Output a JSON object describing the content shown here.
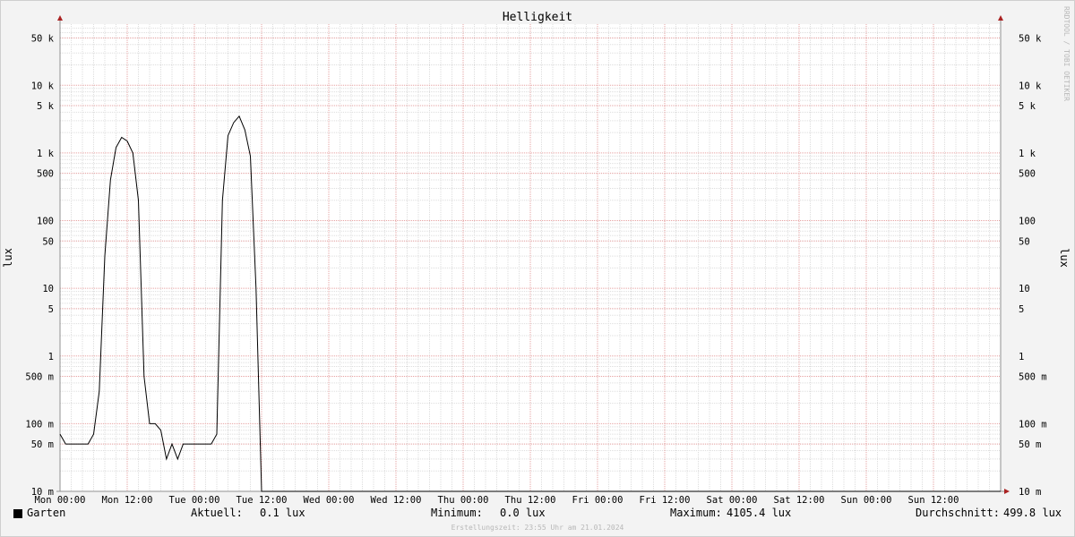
{
  "chart_data": {
    "type": "line",
    "title": "Helligkeit",
    "ylabel": "lux",
    "yscale": "log",
    "ylim": [
      0.01,
      80000
    ],
    "xlim": [
      "Mon 00:00",
      "Sun 23:00"
    ],
    "grid": true,
    "y_ticks": [
      "10 m",
      "50 m",
      "100 m",
      "500 m",
      "1",
      "5",
      "10",
      "50",
      "100",
      "500",
      "1 k",
      "5 k",
      "10 k",
      "50 k"
    ],
    "x_ticks": [
      "Mon 00:00",
      "Mon 12:00",
      "Tue 00:00",
      "Tue 12:00",
      "Wed 00:00",
      "Wed 12:00",
      "Thu 00:00",
      "Thu 12:00",
      "Fri 00:00",
      "Fri 12:00",
      "Sat 00:00",
      "Sat 12:00",
      "Sun 00:00",
      "Sun 12:00"
    ],
    "series": [
      {
        "name": "Garten",
        "color": "#000000",
        "x_hours": [
          0,
          1,
          2,
          3,
          4,
          5,
          6,
          7,
          8,
          9,
          10,
          11,
          12,
          13,
          14,
          15,
          16,
          17,
          18,
          19,
          20,
          21,
          22,
          23,
          24,
          25,
          26,
          27,
          28,
          29,
          30,
          31,
          32,
          33,
          34,
          35,
          36,
          37,
          38,
          39,
          40,
          41,
          42,
          43,
          44,
          45,
          46,
          47,
          48,
          49,
          50,
          51,
          52,
          53,
          54,
          55,
          56,
          57,
          58,
          59,
          60,
          61,
          62,
          63,
          64,
          65,
          66,
          67,
          68,
          69,
          70,
          71,
          72,
          73,
          74,
          75,
          76,
          77,
          78,
          79,
          80,
          81,
          82,
          83,
          84,
          85,
          86,
          87,
          88,
          89,
          90,
          91,
          92,
          93,
          94,
          95,
          96,
          97,
          98,
          99,
          100,
          101,
          102,
          103,
          104,
          105,
          106,
          107,
          108,
          109,
          110,
          111,
          112,
          113,
          114,
          115,
          116,
          117,
          118,
          119,
          120,
          121,
          122,
          123,
          124,
          125,
          126,
          127,
          128,
          129,
          130,
          131,
          132,
          133,
          134,
          135,
          136,
          137,
          138,
          139,
          140,
          141,
          142,
          143,
          144,
          145,
          146,
          147,
          148,
          149,
          150,
          151,
          152,
          153,
          154,
          155,
          156,
          157,
          158,
          159,
          160,
          161,
          162,
          163,
          164,
          165,
          166,
          167,
          168
        ],
        "values": [
          0.07,
          0.05,
          0.05,
          0.05,
          0.05,
          0.05,
          0.07,
          0.3,
          30,
          400,
          1200,
          1700,
          1500,
          1000,
          200,
          0.5,
          0.1,
          0.1,
          0.08,
          0.03,
          0.05,
          0.03,
          0.05,
          0.05,
          0.05,
          0.05,
          0.05,
          0.05,
          0.07,
          200,
          1800,
          2800,
          3500,
          2200,
          900,
          10,
          0.01,
          0.01,
          0.01,
          0.01,
          0.01,
          0.01,
          0.01,
          0.01,
          0.01,
          0.01,
          0.01,
          0.01,
          0.01,
          0.01,
          0.01,
          0.01,
          0.01,
          0.01,
          0.01,
          0.01,
          0.01,
          0.01,
          0.01,
          0.01,
          0.01,
          0.01,
          0.01,
          0.01,
          0.01,
          0.01,
          0.01,
          0.01,
          0.01,
          0.01,
          0.01,
          0.01,
          0.01,
          0.01,
          0.01,
          0.01,
          0.01,
          0.01,
          0.01,
          0.01,
          0.01,
          0.01,
          0.01,
          0.01,
          0.01,
          0.01,
          0.01,
          0.01,
          0.01,
          0.01,
          0.01,
          0.01,
          0.01,
          0.01,
          0.01,
          0.01,
          0.01,
          0.01,
          0.01,
          0.01,
          0.01,
          0.01,
          0.01,
          0.01,
          0.01,
          0.01,
          0.01,
          0.01,
          0.01,
          0.01,
          0.01,
          0.01,
          0.01,
          0.01,
          0.01,
          0.01,
          0.01,
          0.01,
          0.01,
          0.01,
          0.01,
          0.01,
          0.01,
          0.01,
          0.01,
          0.01,
          0.01,
          0.01,
          0.01,
          0.01,
          0.01,
          0.01,
          0.01,
          0.01,
          0.01,
          0.01,
          0.01,
          0.01,
          0.01,
          0.01,
          0.01,
          0.01,
          0.01,
          0.01,
          0.01,
          0.01,
          0.01,
          0.01,
          0.01,
          0.01,
          0.01,
          0.01,
          0.01,
          0.01,
          0.01,
          0.01,
          0.01,
          0.01,
          0.01,
          0.01,
          0.01,
          0.01,
          0.01,
          0.01,
          0.01,
          0.01,
          0.01,
          0.01,
          0.01,
          0.01,
          0.01,
          0.01,
          0.06
        ]
      }
    ]
  },
  "legend": {
    "series_name": "Garten",
    "aktuell_label": "Aktuell:",
    "aktuell_value": "0.1 lux",
    "minimum_label": "Minimum:",
    "minimum_value": "0.0 lux",
    "maximum_label": "Maximum:",
    "maximum_value": "4105.4 lux",
    "avg_label": "Durchschnitt:",
    "avg_value": "499.8 lux"
  },
  "credit": "RRDTOOL / TOBI OETIKER",
  "footer": "Erstellungszeit: 23:55 Uhr am 21.01.2024"
}
